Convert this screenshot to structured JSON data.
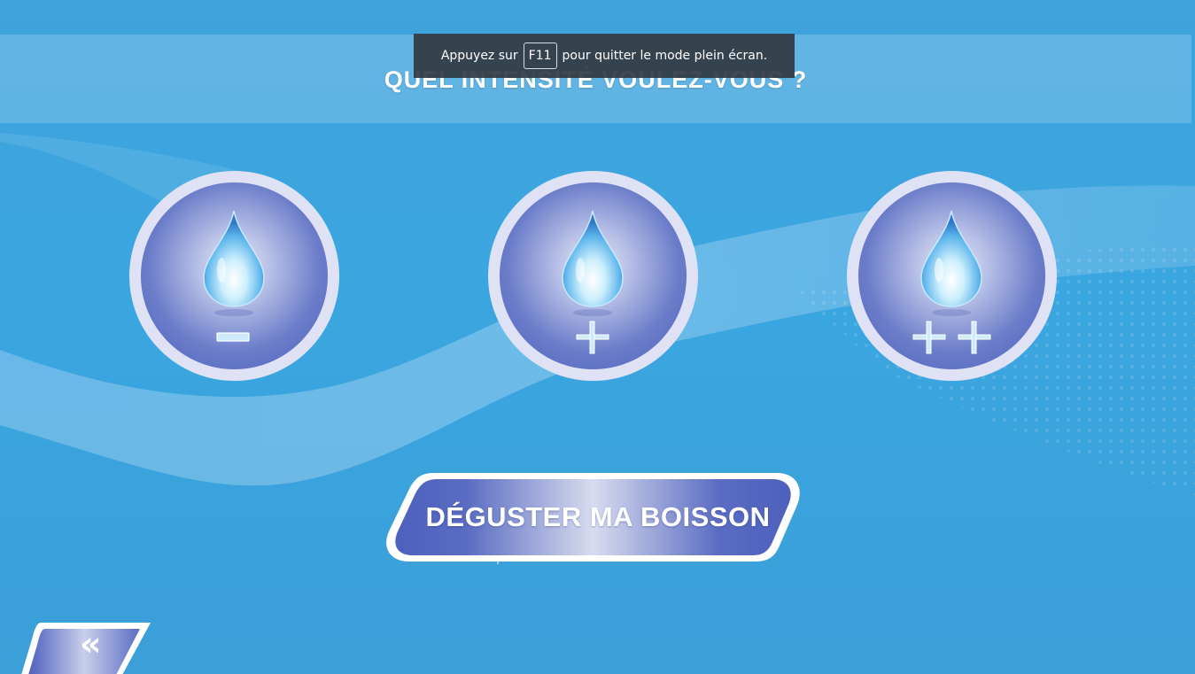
{
  "header": {
    "question": "QUEL INTENSITÉ VOULEZ-VOUS ?"
  },
  "fullscreen_toast": {
    "prefix": "Appuyez sur",
    "key": "F11",
    "suffix": "pour quitter le mode plein écran."
  },
  "intensity_options": [
    {
      "icon": "water-drop-icon",
      "symbol": "minus-icon"
    },
    {
      "icon": "water-drop-icon",
      "symbol": "plus-icon"
    },
    {
      "icon": "water-drop-icon",
      "symbol": "double-plus-icon"
    }
  ],
  "cta": {
    "label": "DÉGUSTER MA BOISSON"
  },
  "back": {
    "glyph": "«",
    "icon": "double-chevron-left-icon"
  },
  "colors": {
    "background": "#3aa6e0",
    "button_blue": "#4d60bd",
    "ring": "#dfe2f5",
    "white": "#ffffff"
  }
}
